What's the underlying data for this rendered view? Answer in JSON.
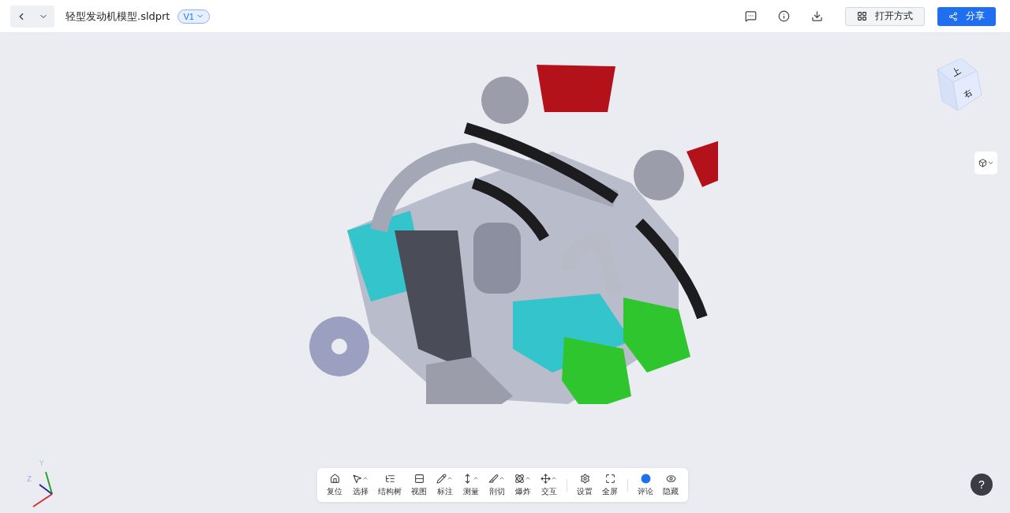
{
  "header": {
    "file_name": "轻型发动机模型.sldprt",
    "version": "V1",
    "open_with": "打开方式",
    "share": "分享"
  },
  "view_cube": {
    "top": "上",
    "right": "右"
  },
  "axes": {
    "y": "Y",
    "z": "Z"
  },
  "toolbar": {
    "groups": [
      [
        {
          "label": "复位",
          "has_menu": false,
          "active": false
        },
        {
          "label": "选择",
          "has_menu": true,
          "active": false
        },
        {
          "label": "结构树",
          "has_menu": false,
          "active": false
        },
        {
          "label": "视图",
          "has_menu": false,
          "active": false
        },
        {
          "label": "标注",
          "has_menu": true,
          "active": false
        },
        {
          "label": "测量",
          "has_menu": true,
          "active": false
        },
        {
          "label": "剖切",
          "has_menu": true,
          "active": false
        },
        {
          "label": "爆炸",
          "has_menu": true,
          "active": false
        },
        {
          "label": "交互",
          "has_menu": true,
          "active": false
        }
      ],
      [
        {
          "label": "设置",
          "has_menu": false,
          "active": false
        },
        {
          "label": "全屏",
          "has_menu": false,
          "active": false
        }
      ],
      [
        {
          "label": "评论",
          "has_menu": false,
          "active": true
        },
        {
          "label": "隐藏",
          "has_menu": false,
          "active": false
        }
      ]
    ]
  },
  "help": "?"
}
